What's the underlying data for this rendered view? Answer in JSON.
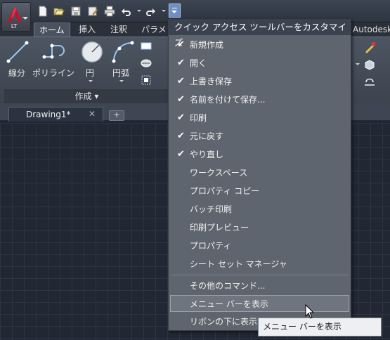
{
  "app": {
    "badge": "LT"
  },
  "quick_access": {
    "icons": [
      "new-icon",
      "open-icon",
      "save-icon",
      "save-as-icon",
      "print-icon",
      "undo-icon",
      "redo-icon"
    ]
  },
  "ribbon_tabs": [
    {
      "label": "ホーム",
      "active": true
    },
    {
      "label": "挿入"
    },
    {
      "label": "注釈"
    },
    {
      "label": "パラメ"
    }
  ],
  "ribbon_tab_right": "Autodesk",
  "ribbon": {
    "tools": [
      {
        "label": "線分"
      },
      {
        "label": "ポリライン"
      },
      {
        "label": "円"
      },
      {
        "label": "円弧"
      }
    ],
    "panel_title": "作成 ▾"
  },
  "document": {
    "tab_title": "Drawing1*",
    "close_glyph": "✕",
    "new_tab_glyph": "+"
  },
  "menu": {
    "header": "クイック アクセス ツールバーをカスタマイズ",
    "items": [
      {
        "label": "新規作成",
        "checked": true
      },
      {
        "label": "開く",
        "checked": true
      },
      {
        "label": "上書き保存",
        "checked": true
      },
      {
        "label": "名前を付けて保存...",
        "checked": true
      },
      {
        "label": "印刷",
        "checked": true
      },
      {
        "label": "元に戻す",
        "checked": true
      },
      {
        "label": "やり直し",
        "checked": true
      },
      {
        "label": "ワークスペース",
        "checked": false
      },
      {
        "label": "プロパティ コピー",
        "checked": false
      },
      {
        "label": "バッチ印刷",
        "checked": false
      },
      {
        "label": "印刷プレビュー",
        "checked": false
      },
      {
        "label": "プロパティ",
        "checked": false
      },
      {
        "label": "シート セット マネージャ",
        "checked": false
      }
    ],
    "extra_items": [
      {
        "label": "その他のコマンド..."
      },
      {
        "label": "メニュー バーを表示",
        "hovered": true
      },
      {
        "label": "リボンの下に表示"
      }
    ],
    "check_glyph": "✔"
  },
  "tooltip": {
    "text": "メニュー バーを表示"
  },
  "colors": {
    "accent": "#6d8fc2",
    "menu_bg": "#5f656e",
    "canvas": "#212834",
    "logo_red": "#c8102e"
  }
}
